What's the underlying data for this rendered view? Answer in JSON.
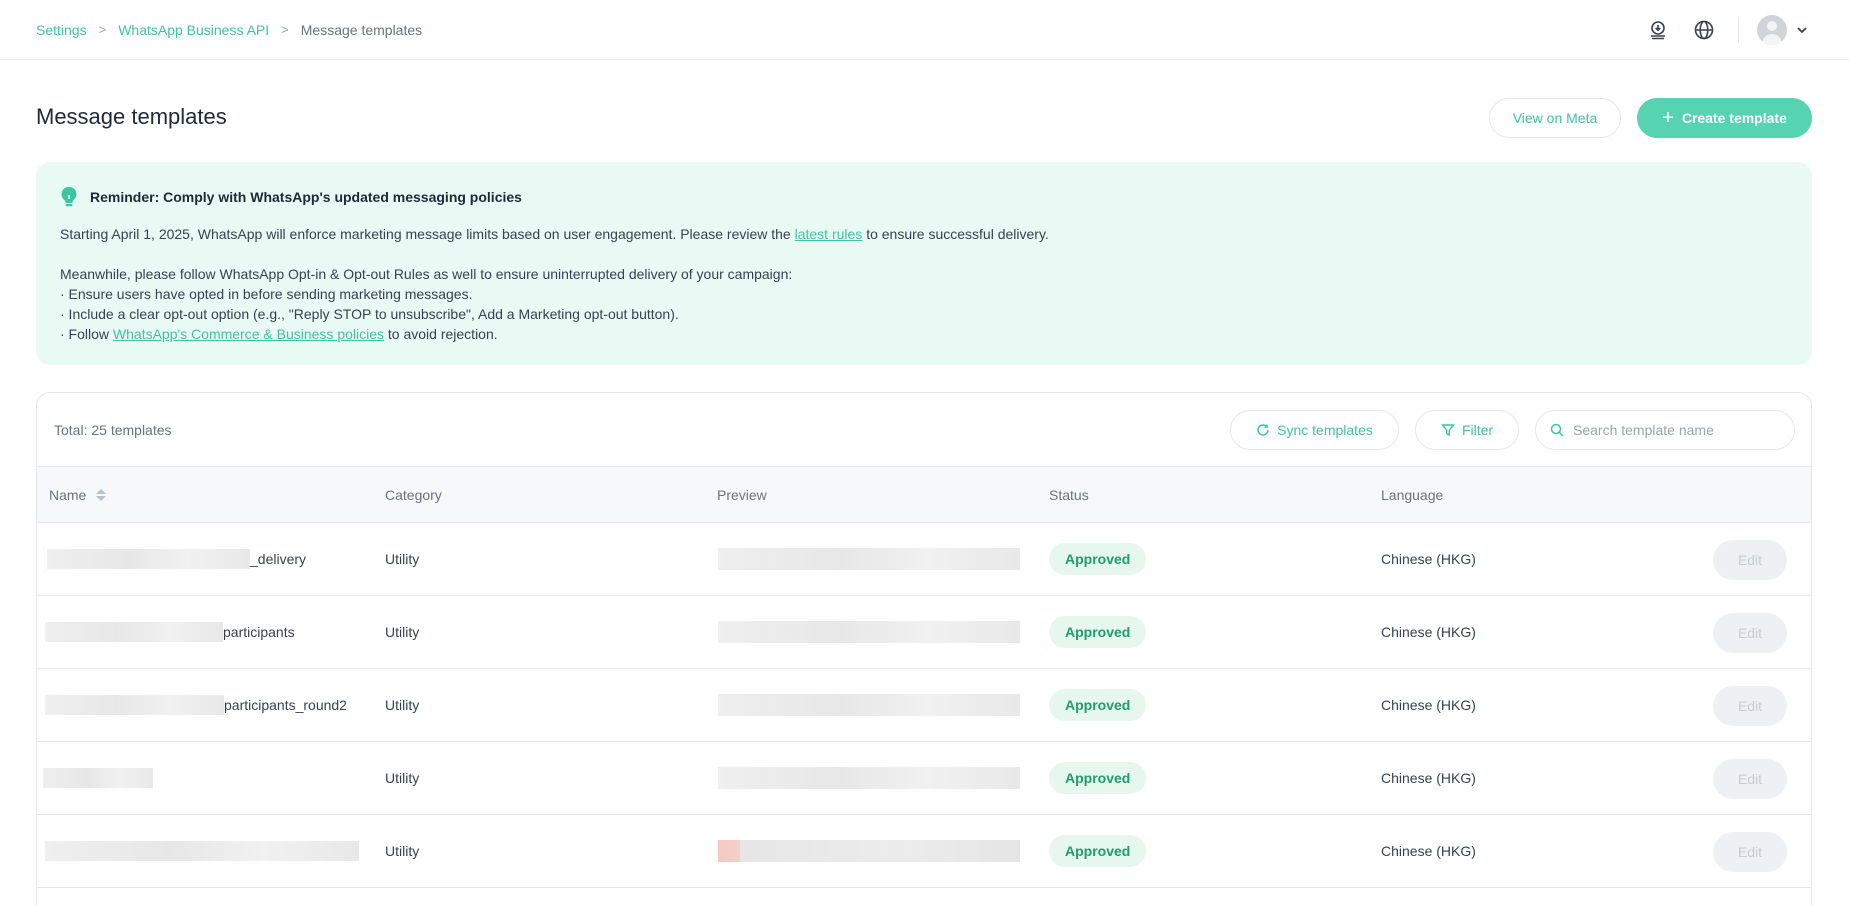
{
  "breadcrumb": {
    "items": [
      "Settings",
      "WhatsApp Business API"
    ],
    "current": "Message templates"
  },
  "topbar": {
    "icons": [
      "download-icon",
      "globe-icon",
      "avatar",
      "chevron-down-icon"
    ]
  },
  "header": {
    "title": "Message templates",
    "view_on_meta": "View on Meta",
    "create_template": "Create template"
  },
  "banner": {
    "title": "Reminder: Comply with WhatsApp's updated messaging policies",
    "line1_before": "Starting April 1, 2025, WhatsApp will enforce marketing message limits based on user engagement. Please review the ",
    "line1_link": "latest rules",
    "line1_after": " to ensure successful delivery.",
    "line2": "Meanwhile, please follow WhatsApp Opt-in & Opt-out Rules as well to ensure uninterrupted delivery of your campaign:",
    "bullet1": "· Ensure users have opted in before sending marketing messages.",
    "bullet2": "· Include a clear opt-out option (e.g., \"Reply STOP to unsubscribe\", Add a Marketing opt-out button).",
    "bullet3_before": "· Follow ",
    "bullet3_link": "WhatsApp's Commerce & Business policies",
    "bullet3_after": " to avoid rejection."
  },
  "table": {
    "total": "Total: 25 templates",
    "sync": "Sync templates",
    "filter": "Filter",
    "search_placeholder": "Search template name",
    "columns": [
      "Name",
      "Category",
      "Preview",
      "Status",
      "Language"
    ],
    "rows": [
      {
        "name": "_delivery",
        "category": "Utility",
        "status": "Approved",
        "language": "Chinese (HKG)",
        "action": "Edit"
      },
      {
        "name": "participants",
        "category": "Utility",
        "status": "Approved",
        "language": "Chinese (HKG)",
        "action": "Edit"
      },
      {
        "name": "participants_round2",
        "category": "Utility",
        "status": "Approved",
        "language": "Chinese (HKG)",
        "action": "Edit"
      },
      {
        "name": "",
        "category": "Utility",
        "status": "Approved",
        "language": "Chinese (HKG)",
        "action": "Edit"
      },
      {
        "name": "",
        "category": "Utility",
        "status": "Approved",
        "language": "Chinese (HKG)",
        "action": "Edit"
      }
    ]
  },
  "colors": {
    "accent": "#3cc6a0",
    "primary_button": "#56d3b0",
    "banner_bg": "#e9faf5",
    "approved_text": "#1f9d6b",
    "approved_bg": "#e6f7f0"
  }
}
